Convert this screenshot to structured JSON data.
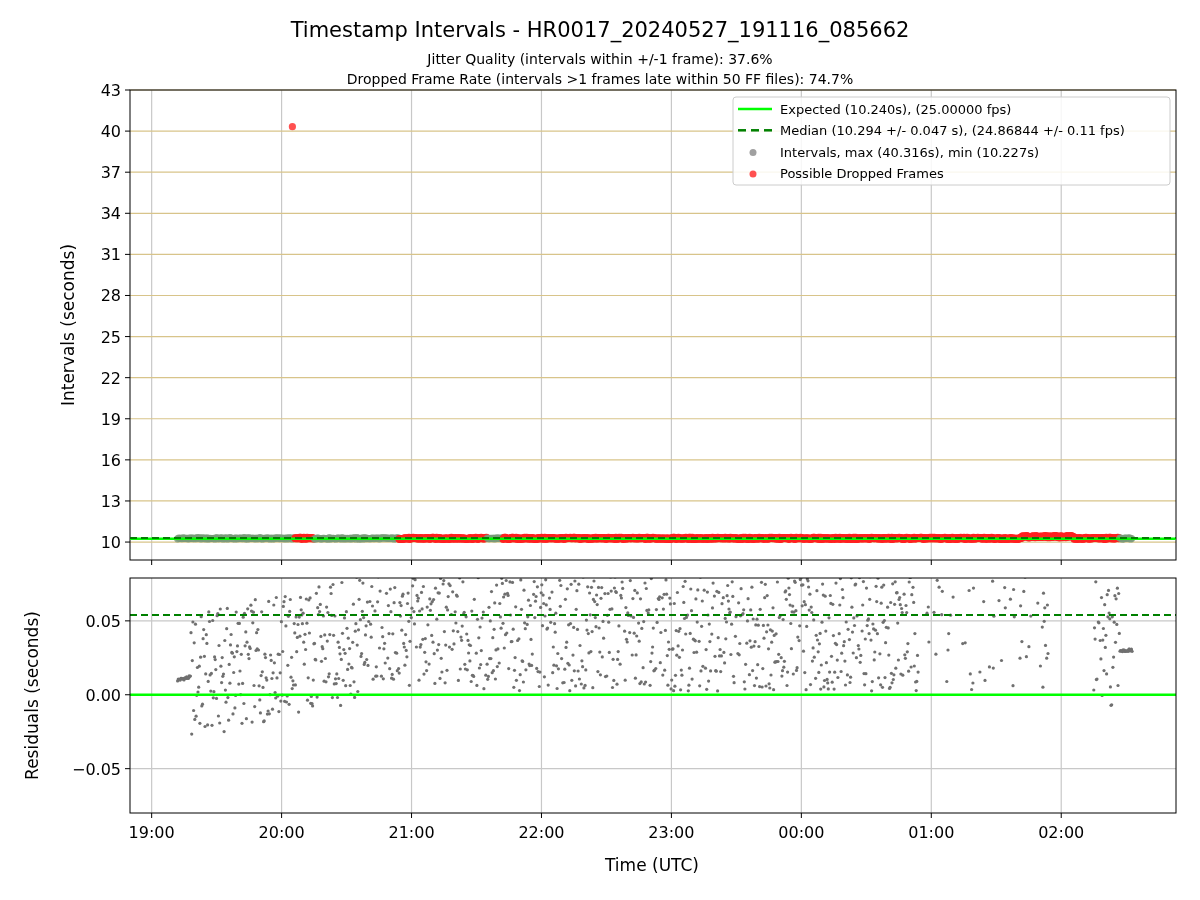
{
  "figure": {
    "title": "Timestamp Intervals - HR0017_20240527_191116_085662",
    "subtitles": [
      "Jitter Quality (intervals within +/-1 frame): 37.6%",
      "Dropped Frame Rate (intervals >1 frames late within 50 FF files): 74.7%"
    ]
  },
  "intervals_panel": {
    "chart_data": {
      "type": "scatter",
      "ylabel": "Intervals (seconds)",
      "grid": true,
      "x": [
        "2024-05-27T20:05"
      ],
      "xlim": [
        "2024-05-27T18:50",
        "2024-05-28T02:53"
      ],
      "ylim": [
        8.69,
        43
      ],
      "yticks": [
        {
          "value": 10,
          "label": "10"
        },
        {
          "value": 13,
          "label": "13"
        },
        {
          "value": 16,
          "label": "16"
        },
        {
          "value": 19,
          "label": "19"
        },
        {
          "value": 22,
          "label": "22"
        },
        {
          "value": 25,
          "label": "25"
        },
        {
          "value": 28,
          "label": "28"
        },
        {
          "value": 31,
          "label": "31"
        },
        {
          "value": 34,
          "label": "34"
        },
        {
          "value": 37,
          "label": "37"
        },
        {
          "value": 40,
          "label": "40"
        },
        {
          "value": 43,
          "label": "43"
        }
      ],
      "series": [
        {
          "name": "Possible Dropped Frames",
          "color": "#ff5050",
          "values": [
            40.32
          ]
        }
      ]
    },
    "legend": [
      {
        "label": "Expected (10.240s), (25.00000 fps)",
        "kind": "solid",
        "color": "#00ff00"
      },
      {
        "label": "Median (10.294 +/- 0.047 s), (24.86844 +/- 0.11 fps)",
        "kind": "dashed",
        "color": "#008000"
      },
      {
        "label": "Intervals, max (40.316s), min (10.227s)",
        "kind": "dot",
        "color": "#a0a0a0"
      }
    ]
  },
  "residuals_panel": {
    "chart_data": {
      "type": "line",
      "xlabel": "Time (UTC)",
      "ylabel": "Residuals (seconds)",
      "grid": true,
      "x": [
        "2024-05-27T18:50",
        "2024-05-28T02:53"
      ],
      "xlim": [
        "2024-05-27T18:50",
        "2024-05-28T02:53"
      ],
      "ylim": [
        -0.08,
        0.079
      ],
      "yticks": [
        {
          "value": -0.05,
          "label": "−0.05"
        },
        {
          "value": 0,
          "label": "0.00"
        },
        {
          "value": 0.05,
          "label": "0.05"
        }
      ],
      "xticks": [
        {
          "value": "2024-05-27T19:00",
          "label": "19:00"
        },
        {
          "value": "2024-05-27T20:00",
          "label": "20:00"
        },
        {
          "value": "2024-05-27T21:00",
          "label": "21:00"
        },
        {
          "value": "2024-05-27T22:00",
          "label": "22:00"
        },
        {
          "value": "2024-05-27T23:00",
          "label": "23:00"
        },
        {
          "value": "2024-05-28T00:00",
          "label": "00:00"
        },
        {
          "value": "2024-05-28T01:00",
          "label": "01:00"
        },
        {
          "value": "2024-05-28T02:00",
          "label": "02:00"
        }
      ],
      "series": [
        {
          "color": "#00ff00",
          "line_style": "solid",
          "values": [
            0,
            0
          ]
        },
        {
          "color": "#008000",
          "line_style": "dashed",
          "values": [
            0.054,
            0.054
          ]
        }
      ]
    }
  }
}
